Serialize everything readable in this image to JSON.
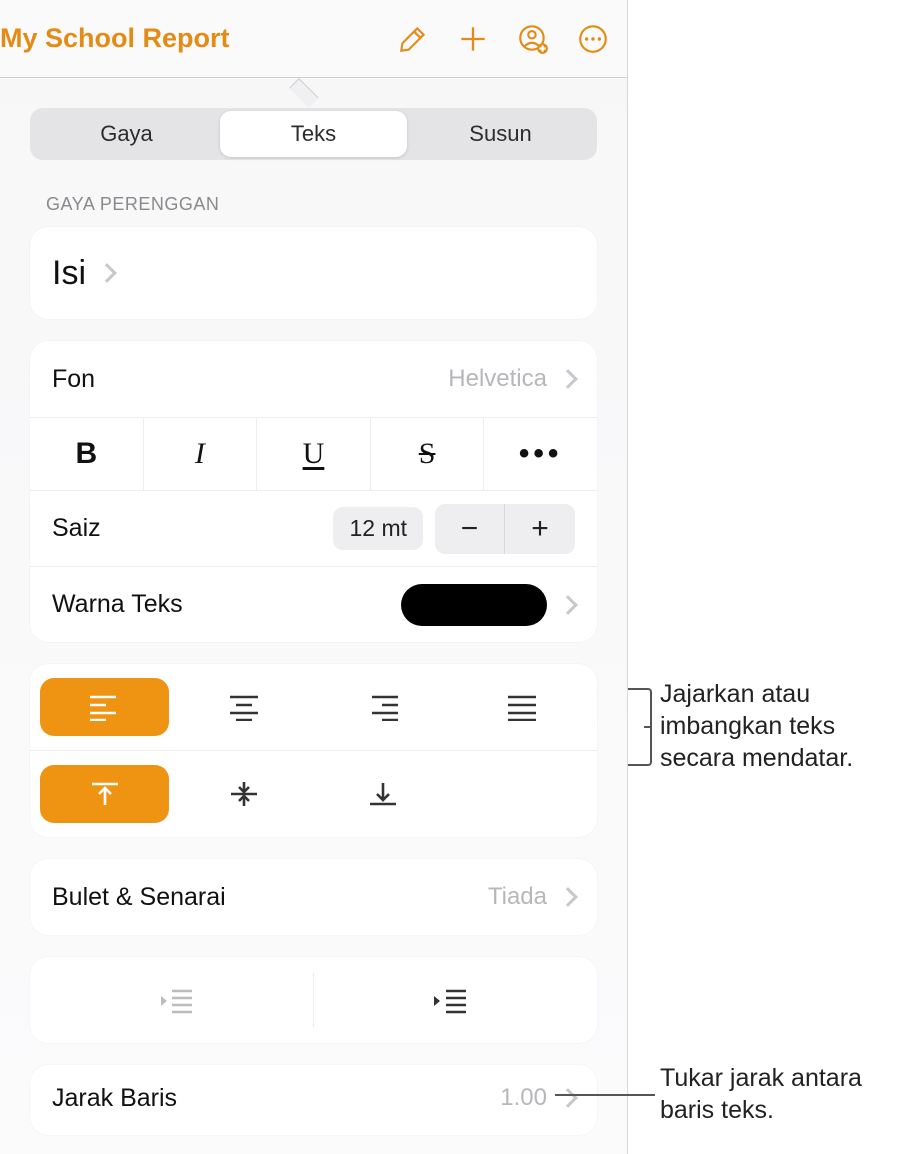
{
  "toolbar": {
    "title": "My School Report"
  },
  "tabs": {
    "style": "Gaya",
    "text": "Teks",
    "arrange": "Susun"
  },
  "section_paragraph_style": "GAYA PERENGGAN",
  "paragraph_style_value": "Isi",
  "font": {
    "label": "Fon",
    "value": "Helvetica"
  },
  "styleglyphs": {
    "bold": "B",
    "italic": "I",
    "underline": "U",
    "strike": "S",
    "more": "•••"
  },
  "size": {
    "label": "Saiz",
    "value": "12 mt"
  },
  "textcolor": {
    "label": "Warna Teks",
    "value": "#000000"
  },
  "bullets": {
    "label": "Bulet & Senarai",
    "value": "Tiada"
  },
  "linespacing": {
    "label": "Jarak Baris",
    "value": "1.00"
  },
  "annotations": {
    "align": "Jajarkan atau imbangkan teks secara mendatar.",
    "linespacing": "Tukar jarak antara baris teks."
  }
}
